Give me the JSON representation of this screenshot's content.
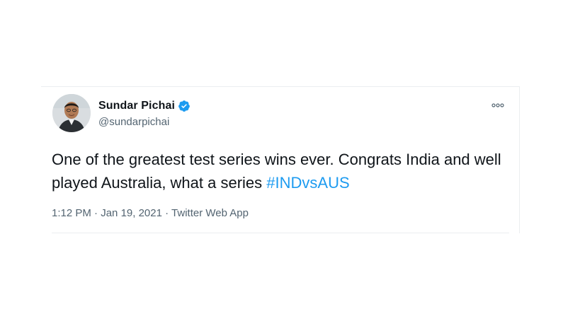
{
  "tweet": {
    "author": {
      "display_name": "Sundar Pichai",
      "handle": "@sundarpichai",
      "verified": true
    },
    "text_plain": "One of the greatest test series wins ever. Congrats India and well played Australia, what a series ",
    "hashtag": "#INDvsAUS",
    "time": "1:12 PM",
    "separator": "·",
    "date": "Jan 19, 2021",
    "source": "Twitter Web App"
  },
  "colors": {
    "text_primary": "#0f1419",
    "text_secondary": "#536471",
    "link": "#1d9bf0",
    "verified_badge": "#1d9bf0"
  },
  "icons": {
    "verified": "verified-badge-icon",
    "more": "more-options-icon"
  }
}
